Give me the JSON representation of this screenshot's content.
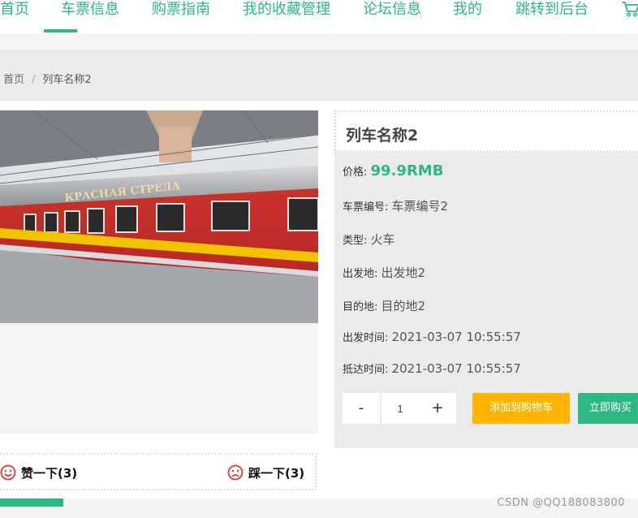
{
  "nav": {
    "items": [
      {
        "label": "首页"
      },
      {
        "label": "车票信息"
      },
      {
        "label": "购票指南"
      },
      {
        "label": "我的收藏管理"
      },
      {
        "label": "论坛信息"
      },
      {
        "label": "我的"
      },
      {
        "label": "跳转到后台"
      }
    ],
    "active_index": 1,
    "cart_icon": "cart-icon"
  },
  "breadcrumb": {
    "home": "首页",
    "separator": "/",
    "current": "列车名称2"
  },
  "product": {
    "title": "列车名称2",
    "price_label": "价格:",
    "price_value": "99.9RMB",
    "ticket_no_label": "车票编号:",
    "ticket_no_value": "车票编号2",
    "type_label": "类型:",
    "type_value": "火车",
    "from_label": "出发地:",
    "from_value": "出发地2",
    "to_label": "目的地:",
    "to_value": "目的地2",
    "depart_label": "出发时间:",
    "depart_value": "2021-03-07 10:55:57",
    "arrive_label": "抵达时间:",
    "arrive_value": "2021-03-07 10:55:57"
  },
  "quantity": {
    "minus": "-",
    "value": "1",
    "plus": "+"
  },
  "buttons": {
    "add_to_cart": "添加到购物车",
    "buy_now": "立即购买"
  },
  "votes": {
    "like": "赞一下(3)",
    "dislike": "踩一下(3)"
  },
  "watermark": "CSDN @QQ188083800",
  "colors": {
    "accent": "#2db782",
    "warning": "#ffb400",
    "vote_icon": "#e03131"
  }
}
